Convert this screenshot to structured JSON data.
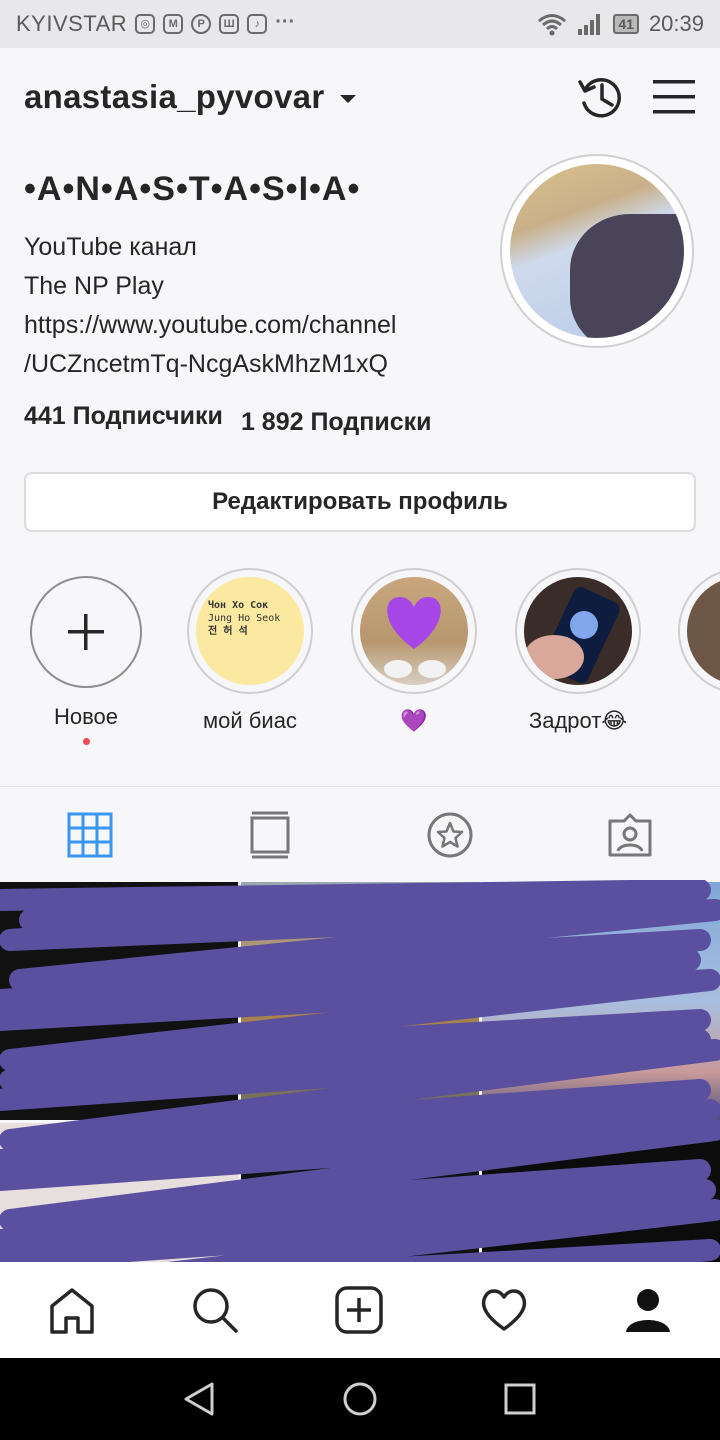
{
  "status_bar": {
    "carrier": "KYIVSTAR",
    "notification_icons": [
      "instagram-icon",
      "gmail-icon",
      "pinterest-icon",
      "app-icon",
      "music-icon"
    ],
    "more": "···",
    "battery": "41",
    "time": "20:39"
  },
  "header": {
    "username": "anastasia_pyvovar",
    "icons": [
      "archive-history-icon",
      "menu-icon"
    ]
  },
  "profile": {
    "full_name": "•A•N•A•S•T•A•S•I•A•",
    "bio_lines": [
      "YouTube канал",
      "The NP Play",
      "https://www.youtube.com/channel",
      "/UCZncetmTq-NcgAskMhzM1xQ"
    ],
    "followers": "441 Подписчики",
    "following": "1 892 Подписки",
    "edit_button": "Редактировать профиль"
  },
  "highlights": [
    {
      "label": "Новое",
      "type": "new"
    },
    {
      "label": "мой биас",
      "cover_text": [
        "Чон Хо Сок",
        "Jung Ho Seok",
        "전 허 석"
      ]
    },
    {
      "label": "💜",
      "cover": "purple-heart"
    },
    {
      "label": "Задрот😂",
      "cover": "phone-photo"
    },
    {
      "label": "",
      "cover": "partial"
    }
  ],
  "tabs": [
    "grid-icon",
    "feed-icon",
    "saved-star-icon",
    "tagged-icon"
  ],
  "bottom_nav": [
    "home-icon",
    "search-icon",
    "add-post-icon",
    "activity-heart-icon",
    "profile-icon"
  ],
  "system_nav": [
    "back-icon",
    "home-circle-icon",
    "recents-icon"
  ],
  "colors": {
    "accent_blue": "#3897f0",
    "scribble_purple": "#5b4fa0",
    "notification_dot": "#ed4956"
  }
}
